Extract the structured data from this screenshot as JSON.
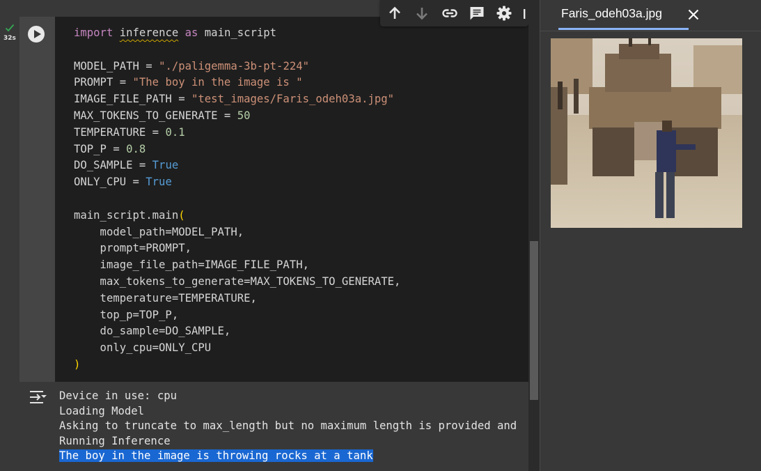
{
  "toolbar": {
    "icons": [
      "arrow-up-icon",
      "arrow-down-icon",
      "link-icon",
      "comment-icon",
      "gear-icon",
      "more-icon"
    ]
  },
  "cell": {
    "status_icon": "check-icon",
    "exec_time": "32s",
    "run_icon": "play-icon",
    "code": [
      [
        {
          "t": "import",
          "c": "kw"
        },
        {
          "t": " "
        },
        {
          "t": "inference",
          "c": "squig"
        },
        {
          "t": " "
        },
        {
          "t": "as",
          "c": "kw"
        },
        {
          "t": " main_script"
        }
      ],
      [],
      [
        {
          "t": "MODEL_PATH = "
        },
        {
          "t": "\"./paligemma-3b-pt-224\"",
          "c": "str"
        }
      ],
      [
        {
          "t": "PROMPT = "
        },
        {
          "t": "\"The boy in the image is \"",
          "c": "str"
        }
      ],
      [
        {
          "t": "IMAGE_FILE_PATH = "
        },
        {
          "t": "\"test_images/Faris_odeh03a.jpg\"",
          "c": "str"
        }
      ],
      [
        {
          "t": "MAX_TOKENS_TO_GENERATE = "
        },
        {
          "t": "50",
          "c": "num"
        }
      ],
      [
        {
          "t": "TEMPERATURE = "
        },
        {
          "t": "0.1",
          "c": "num"
        }
      ],
      [
        {
          "t": "TOP_P = "
        },
        {
          "t": "0.8",
          "c": "num"
        }
      ],
      [
        {
          "t": "DO_SAMPLE = "
        },
        {
          "t": "True",
          "c": "bool"
        }
      ],
      [
        {
          "t": "ONLY_CPU = "
        },
        {
          "t": "True",
          "c": "bool"
        }
      ],
      [],
      [
        {
          "t": "main_script.main"
        },
        {
          "t": "(",
          "c": "paren"
        }
      ],
      [
        {
          "t": "    model_path=MODEL_PATH,"
        }
      ],
      [
        {
          "t": "    prompt=PROMPT,"
        }
      ],
      [
        {
          "t": "    image_file_path=IMAGE_FILE_PATH,"
        }
      ],
      [
        {
          "t": "    max_tokens_to_generate=MAX_TOKENS_TO_GENERATE,"
        }
      ],
      [
        {
          "t": "    temperature=TEMPERATURE,"
        }
      ],
      [
        {
          "t": "    top_p=TOP_P,"
        }
      ],
      [
        {
          "t": "    do_sample=DO_SAMPLE,"
        }
      ],
      [
        {
          "t": "    only_cpu=ONLY_CPU"
        }
      ],
      [
        {
          "t": ")",
          "c": "paren"
        }
      ]
    ]
  },
  "output": {
    "icon": "output-actions-icon",
    "lines": [
      {
        "text": "Device in use: cpu",
        "highlight": false
      },
      {
        "text": "Loading Model",
        "highlight": false
      },
      {
        "text": "Asking to truncate to max_length but no maximum length is provided and",
        "highlight": false
      },
      {
        "text": "Running Inference",
        "highlight": false
      },
      {
        "text": "The boy in the image is throwing rocks at a tank",
        "highlight": true
      }
    ]
  },
  "side_panel": {
    "tab_label": "Faris_odeh03a.jpg",
    "close_icon": "close-icon",
    "image_name": "image-preview"
  },
  "colors": {
    "keyword": "#c586c0",
    "string": "#ce9178",
    "number": "#b5cea8",
    "boolean": "#569cd6",
    "bracket": "#ffd700",
    "selection": "#1967d2",
    "tab_accent": "#8ab4f8",
    "success": "#34a853"
  }
}
